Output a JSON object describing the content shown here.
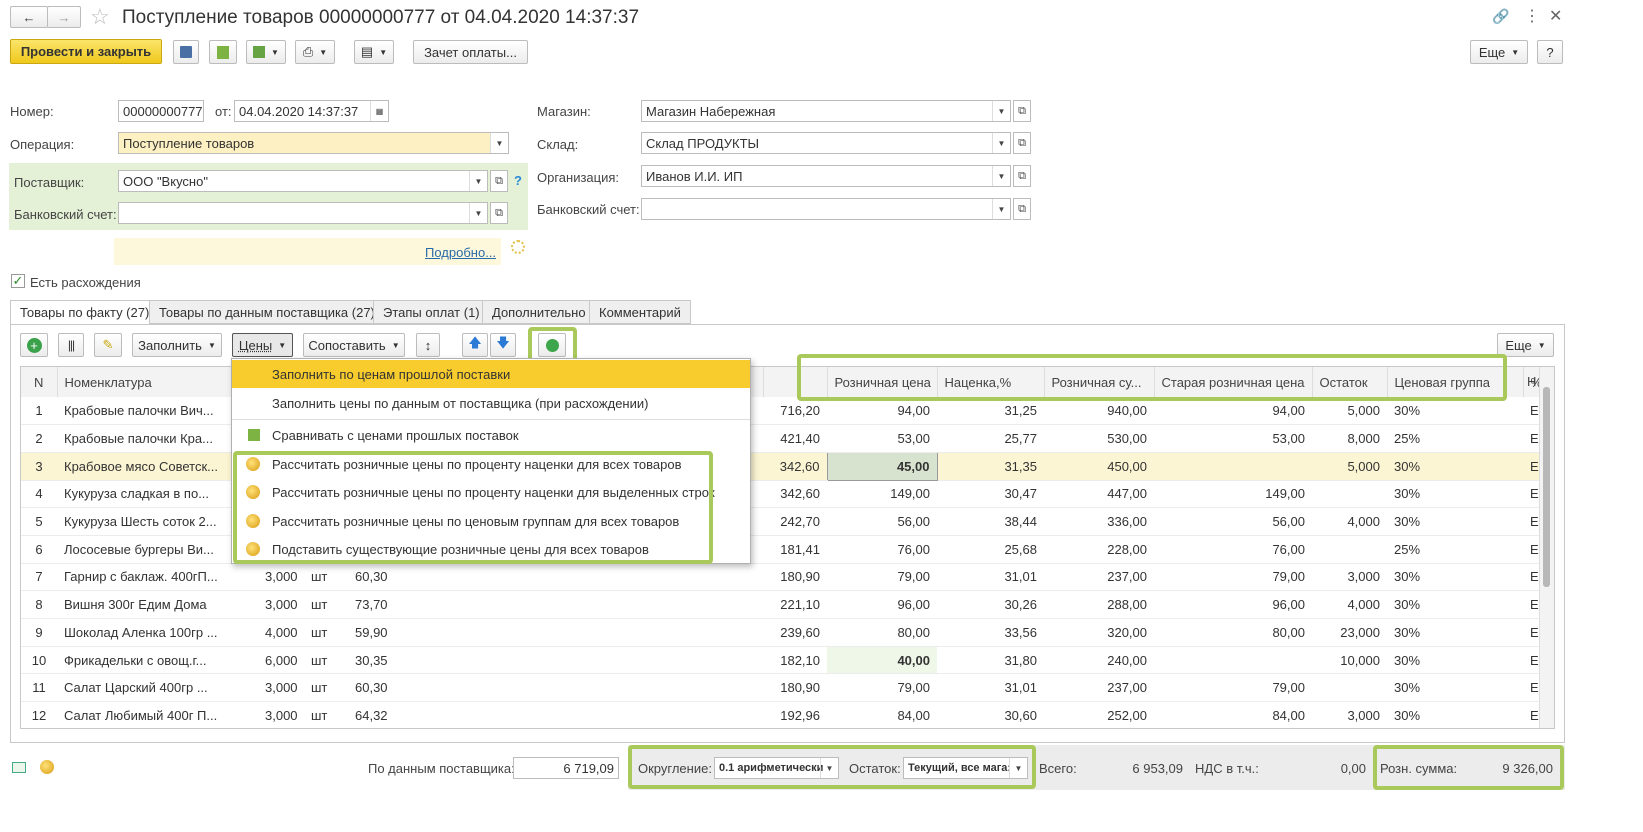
{
  "window": {
    "title": "Поступление товаров 00000000777 от 04.04.2020 14:37:37"
  },
  "toolbar": {
    "post_close": "Провести и закрыть",
    "payment": "Зачет оплаты...",
    "more": "Еще",
    "help": "?"
  },
  "form": {
    "number_label": "Номер:",
    "number_value": "00000000777",
    "from_label": "от:",
    "date_value": "04.04.2020 14:37:37",
    "operation_label": "Операция:",
    "operation_value": "Поступление товаров",
    "supplier_label": "Поставщик:",
    "supplier_value": "ООО \"Вкусно\"",
    "bank_label": "Банковский счет:",
    "bank_value": "",
    "details_link": "Подробно...",
    "store_label": "Магазин:",
    "store_value": "Магазин Набережная",
    "warehouse_label": "Склад:",
    "warehouse_value": "Склад ПРОДУКТЫ",
    "org_label": "Организация:",
    "org_value": "Иванов И.И. ИП",
    "bank2_label": "Банковский счет:",
    "bank2_value": "",
    "discrepancy_label": "Есть расхождения"
  },
  "tabs": [
    "Товары по факту (27)",
    "Товары по данным поставщика (27)",
    "Этапы оплат (1)",
    "Дополнительно",
    "Комментарий"
  ],
  "table_toolbar": {
    "fill": "Заполнить",
    "prices": "Цены",
    "match": "Сопоставить",
    "more": "Еще"
  },
  "columns": {
    "n": "N",
    "name": "Номенклатура",
    "retail": "Розничная цена",
    "markup": "Наценка,%",
    "retail_sum": "Розничная су...",
    "old_retail": "Старая розничная цена",
    "stock": "Остаток",
    "price_group": "Ценовая группа",
    "pct": "%",
    "h": "Н"
  },
  "rows": [
    {
      "n": "1",
      "name": "Крабовые палочки Вич...",
      "qty": "",
      "unit": "",
      "price": "",
      "sum": "716,20",
      "retail": "94,00",
      "markup": "31,25",
      "rsum": "940,00",
      "old": "94,00",
      "stock": "5,000",
      "group": "30%",
      "e": "Е"
    },
    {
      "n": "2",
      "name": "Крабовые палочки Кра...",
      "qty": "",
      "unit": "",
      "price": "",
      "sum": "421,40",
      "retail": "53,00",
      "markup": "25,77",
      "rsum": "530,00",
      "old": "53,00",
      "stock": "8,000",
      "group": "25%",
      "e": "Е"
    },
    {
      "n": "3",
      "name": "Крабовое мясо Советск...",
      "qty": "",
      "unit": "",
      "price": "",
      "sum": "342,60",
      "retail": "45,00",
      "markup": "31,35",
      "rsum": "450,00",
      "old": "",
      "stock": "5,000",
      "group": "30%",
      "e": "Е"
    },
    {
      "n": "4",
      "name": "Кукуруза сладкая в по...",
      "qty": "",
      "unit": "",
      "price": "",
      "sum": "342,60",
      "retail": "149,00",
      "markup": "30,47",
      "rsum": "447,00",
      "old": "149,00",
      "stock": "",
      "group": "30%",
      "e": "Е"
    },
    {
      "n": "5",
      "name": "Кукуруза Шесть соток 2...",
      "qty": "",
      "unit": "",
      "price": "",
      "sum": "242,70",
      "retail": "56,00",
      "markup": "38,44",
      "rsum": "336,00",
      "old": "56,00",
      "stock": "4,000",
      "group": "30%",
      "e": "Е"
    },
    {
      "n": "6",
      "name": "Лососевые бургеры Ви...",
      "qty": "",
      "unit": "",
      "price": "",
      "sum": "181,41",
      "retail": "76,00",
      "markup": "25,68",
      "rsum": "228,00",
      "old": "76,00",
      "stock": "",
      "group": "25%",
      "e": "Е"
    },
    {
      "n": "7",
      "name": "Гарнир с баклаж. 400гП...",
      "qty": "3,000",
      "unit": "шт",
      "price": "60,30",
      "sum": "180,90",
      "retail": "79,00",
      "markup": "31,01",
      "rsum": "237,00",
      "old": "79,00",
      "stock": "3,000",
      "group": "30%",
      "e": "Е"
    },
    {
      "n": "8",
      "name": "Вишня 300г Едим Дома",
      "qty": "3,000",
      "unit": "шт",
      "price": "73,70",
      "sum": "221,10",
      "retail": "96,00",
      "markup": "30,26",
      "rsum": "288,00",
      "old": "96,00",
      "stock": "4,000",
      "group": "30%",
      "e": "Е"
    },
    {
      "n": "9",
      "name": "Шоколад Аленка 100гр ...",
      "qty": "4,000",
      "unit": "шт",
      "price": "59,90",
      "sum": "239,60",
      "retail": "80,00",
      "markup": "33,56",
      "rsum": "320,00",
      "old": "80,00",
      "stock": "23,000",
      "group": "30%",
      "e": "Е"
    },
    {
      "n": "10",
      "name": "Фрикадельки с овощ.г...",
      "qty": "6,000",
      "unit": "шт",
      "price": "30,35",
      "sum": "182,10",
      "retail": "40,00",
      "markup": "31,80",
      "rsum": "240,00",
      "old": "",
      "stock": "10,000",
      "group": "30%",
      "e": "Е"
    },
    {
      "n": "11",
      "name": "Салат Царский  400гр ...",
      "qty": "3,000",
      "unit": "шт",
      "price": "60,30",
      "sum": "180,90",
      "retail": "79,00",
      "markup": "31,01",
      "rsum": "237,00",
      "old": "79,00",
      "stock": "",
      "group": "30%",
      "e": "Е"
    },
    {
      "n": "12",
      "name": "Салат Любимый 400г П...",
      "qty": "3,000",
      "unit": "шт",
      "price": "64,32",
      "sum": "192,96",
      "retail": "84,00",
      "markup": "30,60",
      "rsum": "252,00",
      "old": "84,00",
      "stock": "3,000",
      "group": "30%",
      "e": "Е"
    }
  ],
  "menu": [
    "Заполнить по ценам прошлой поставки",
    "Заполнить цены по данным от поставщика (при расхождении)",
    "Сравнивать с ценами прошлых поставок",
    "Рассчитать розничные цены по проценту наценки для всех товаров",
    "Рассчитать розничные цены по проценту наценки для выделенных строк",
    "Рассчитать розничные цены по ценовым группам для всех товаров",
    "Подставить существующие розничные цены для всех товаров"
  ],
  "footer": {
    "supplier_label": "По данным поставщика:",
    "supplier_value": "6 719,09",
    "rounding_label": "Округление:",
    "rounding_value": "0.1 арифметически",
    "stock_label": "Остаток:",
    "stock_value": "Текущий, все мага:",
    "total_label": "Всего:",
    "total_value": "6 953,09",
    "vat_label": "НДС в т.ч.:",
    "vat_value": "0,00",
    "retail_label": "Розн. сумма:",
    "retail_value": "9 326,00"
  },
  "colors": {
    "accent_yellow": "#f5d832",
    "highlight_green": "#a9c95a",
    "selected_row": "#fbf5d3"
  }
}
